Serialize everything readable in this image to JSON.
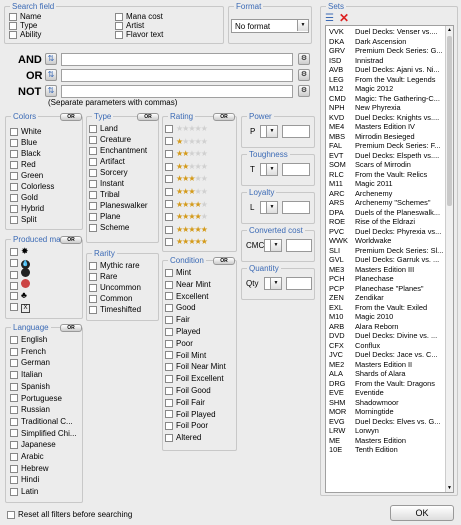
{
  "search_field": {
    "legend": "Search field",
    "items": [
      "Name",
      "Type",
      "Ability",
      "Mana cost",
      "Artist",
      "Flavor text"
    ]
  },
  "format": {
    "legend": "Format",
    "value": "No format"
  },
  "sets": {
    "legend": "Sets",
    "rows": [
      [
        "VVK",
        "Duel Decks: Venser vs...."
      ],
      [
        "DKA",
        "Dark Ascension"
      ],
      [
        "GRV",
        "Premium Deck Series: G..."
      ],
      [
        "ISD",
        "Innistrad"
      ],
      [
        "AVB",
        "Duel Decks: Ajani vs. Ni..."
      ],
      [
        "LEG",
        "From the Vault: Legends"
      ],
      [
        "M12",
        "Magic 2012"
      ],
      [
        "CMD",
        "Magic: The Gathering-C..."
      ],
      [
        "NPH",
        "New Phyrexia"
      ],
      [
        "KVD",
        "Duel Decks: Knights vs...."
      ],
      [
        "ME4",
        "Masters Edition IV"
      ],
      [
        "MBS",
        "Mirrodin Besieged"
      ],
      [
        "FAL",
        "Premium Deck Series: F..."
      ],
      [
        "EVT",
        "Duel Decks: Elspeth vs...."
      ],
      [
        "SOM",
        "Scars of Mirrodin"
      ],
      [
        "RLC",
        "From the Vault: Relics"
      ],
      [
        "M11",
        "Magic 2011"
      ],
      [
        "ARC",
        "Archenemy"
      ],
      [
        "ARS",
        "Archenemy \"Schemes\""
      ],
      [
        "DPA",
        "Duels of the Planeswalk..."
      ],
      [
        "ROE",
        "Rise of the Eldrazi"
      ],
      [
        "PVC",
        "Duel Decks: Phyrexia vs..."
      ],
      [
        "WWK",
        "Worldwake"
      ],
      [
        "SLI",
        "Premium Deck Series: Sl..."
      ],
      [
        "GVL",
        "Duel Decks: Garruk vs. ..."
      ],
      [
        "ME3",
        "Masters Edition III"
      ],
      [
        "PCH",
        "Planechase"
      ],
      [
        "PCP",
        "Planechase \"Planes\""
      ],
      [
        "ZEN",
        "Zendikar"
      ],
      [
        "EXL",
        "From the Vault: Exiled"
      ],
      [
        "M10",
        "Magic 2010"
      ],
      [
        "ARB",
        "Alara Reborn"
      ],
      [
        "DVD",
        "Duel Decks: Divine vs. ..."
      ],
      [
        "CFX",
        "Conflux"
      ],
      [
        "JVC",
        "Duel Decks: Jace vs. C..."
      ],
      [
        "ME2",
        "Masters Edition II"
      ],
      [
        "ALA",
        "Shards of Alara"
      ],
      [
        "DRG",
        "From the Vault: Dragons"
      ],
      [
        "EVE",
        "Eventide"
      ],
      [
        "SHM",
        "Shadowmoor"
      ],
      [
        "MOR",
        "Morningtide"
      ],
      [
        "EVG",
        "Duel Decks: Elves vs. G..."
      ],
      [
        "LRW",
        "Lorwyn"
      ],
      [
        "ME",
        "Masters Edition"
      ],
      [
        "10E",
        "Tenth Edition"
      ]
    ]
  },
  "logic": {
    "and": "AND",
    "or": "OR",
    "not": "NOT",
    "note": "(Separate parameters with commas)"
  },
  "or_label": "OR",
  "colors": {
    "legend": "Colors",
    "items": [
      "White",
      "Blue",
      "Black",
      "Red",
      "Green",
      "Colorless",
      "Gold",
      "Hybrid",
      "Split"
    ]
  },
  "type": {
    "legend": "Type",
    "items": [
      "Land",
      "Creature",
      "Enchantment",
      "Artifact",
      "Sorcery",
      "Instant",
      "Tribal",
      "Planeswalker",
      "Plane",
      "Scheme"
    ]
  },
  "rating": {
    "legend": "Rating",
    "levels": [
      0,
      1,
      1.5,
      2,
      2.5,
      3,
      3.5,
      4,
      4.5,
      5
    ]
  },
  "power": {
    "legend": "Power",
    "label": "P"
  },
  "toughness": {
    "legend": "Toughness",
    "label": "T"
  },
  "loyalty": {
    "legend": "Loyalty",
    "label": "L"
  },
  "converted_cost": {
    "legend": "Converted cost",
    "label": "CMC"
  },
  "quantity": {
    "legend": "Quantity",
    "label": "Qty"
  },
  "produced_mana": {
    "legend": "Produced mana",
    "symbols": [
      "white-mana-icon",
      "blue-mana-icon",
      "black-mana-icon",
      "red-mana-icon",
      "green-mana-icon",
      "colorless-mana-icon"
    ]
  },
  "rarity": {
    "legend": "Rarity",
    "items": [
      "Mythic rare",
      "Rare",
      "Uncommon",
      "Common",
      "Timeshifted"
    ]
  },
  "condition": {
    "legend": "Condition",
    "items": [
      "Mint",
      "Near Mint",
      "Excellent",
      "Good",
      "Fair",
      "Played",
      "Poor",
      "Foil Mint",
      "Foil Near Mint",
      "Foil Excellent",
      "Foil Good",
      "Foil Fair",
      "Foil Played",
      "Foil Poor",
      "Altered"
    ]
  },
  "language": {
    "legend": "Language",
    "items": [
      "English",
      "French",
      "German",
      "Italian",
      "Spanish",
      "Portuguese",
      "Russian",
      "Traditional C...",
      "Simplified Chi...",
      "Japanese",
      "Arabic",
      "Hebrew",
      "Hindi",
      "Latin"
    ]
  },
  "footer": {
    "reset": "Reset all filters before searching",
    "ok": "OK"
  }
}
